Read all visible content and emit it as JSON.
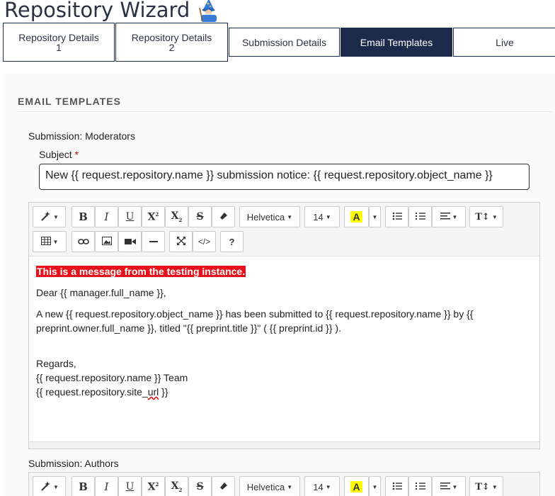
{
  "page": {
    "title": "Repository Wizard"
  },
  "tabs": [
    {
      "label": "Repository Details\n1"
    },
    {
      "label": "Repository Details\n2"
    },
    {
      "label": "Submission Details"
    },
    {
      "label": "Email Templates",
      "active": true
    },
    {
      "label": "Live"
    }
  ],
  "section": {
    "heading": "EMAIL TEMPLATES"
  },
  "moderators": {
    "label": "Submission: Moderators",
    "subject_label": "Subject",
    "required_mark": "*",
    "subject_value": "New {{ request.repository.name }} submission notice: {{ request.repository.object_name }}"
  },
  "toolbar": {
    "font_name": "Helvetica",
    "font_size": "14",
    "help": "?",
    "code": "</>"
  },
  "body": {
    "banner": "This is a message from the testing instance.",
    "greeting": "Dear {{ manager.full_name }},",
    "paragraph": "A new {{ request.repository.object_name }} has been submitted to {{ request.repository.name }} by  {{ preprint.owner.full_name }}, titled \"{{ preprint.title }}\" ( {{ preprint.id }} ).",
    "regards": "Regards,",
    "team": "{{ request.repository.name }} Team",
    "site_prefix": "{{ request.repository.site_",
    "site_url_word": "url",
    "site_suffix": " }}"
  },
  "authors": {
    "label": "Submission: Authors"
  },
  "colors": {
    "accent": "#1e2a4a",
    "banner": "#e8101a",
    "highlight": "#ffff00"
  }
}
